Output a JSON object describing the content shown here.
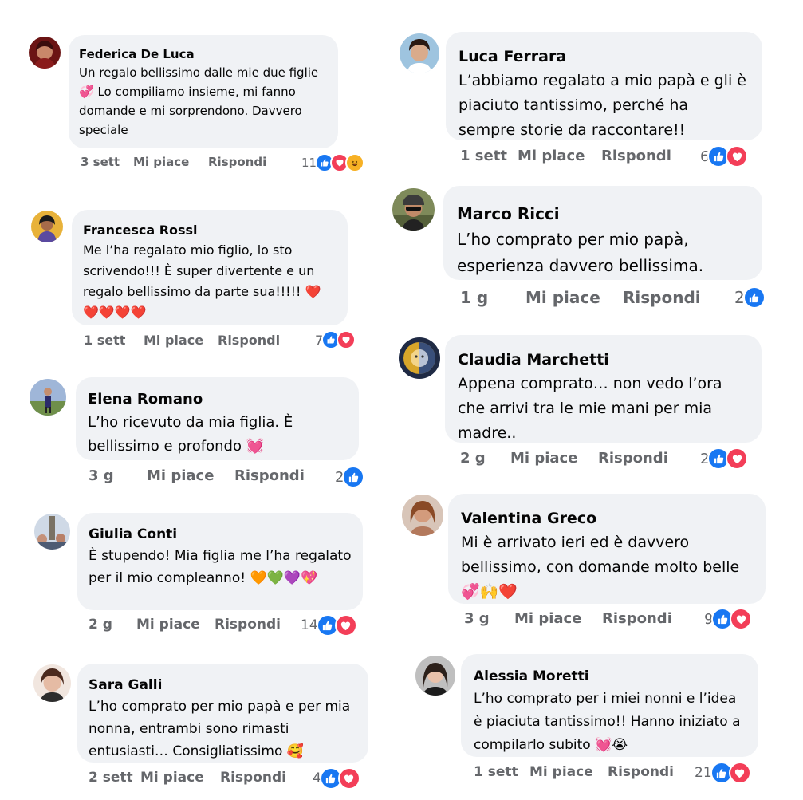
{
  "colors": {
    "bubble": "#f0f2f5",
    "meta_text": "#65676b",
    "like": "#1877f2",
    "love": "#f33e58",
    "haha": "#f7b125"
  },
  "comments": [
    {
      "name": "Federica De Luca",
      "text": "Un regalo bellissimo dalle mie due figlie 💞 Lo compiliamo insieme, mi fanno domande e mi sorprendono. Davvero speciale",
      "time": "3 sett",
      "like": "Mi piace",
      "reply": "Rispondi",
      "count": "11",
      "reactions": [
        "like-icon",
        "love-icon",
        "haha-icon"
      ]
    },
    {
      "name": "Francesca Rossi",
      "text": "Me l’ha regalato mio figlio, lo sto scrivendo!!! È super divertente e un regalo bellissimo da parte sua!!!!! ❤️❤️❤️❤️❤️",
      "time": "1 sett",
      "like": "Mi piace",
      "reply": "Rispondi",
      "count": "7",
      "reactions": [
        "like-icon",
        "love-icon"
      ]
    },
    {
      "name": "Elena Romano",
      "text": "L’ho ricevuto da mia figlia. È bellissimo e profondo 💓",
      "time": "3 g",
      "like": "Mi piace",
      "reply": "Rispondi",
      "count": "2",
      "reactions": [
        "like-icon"
      ]
    },
    {
      "name": "Giulia Conti",
      "text": "È stupendo! Mia figlia me l’ha regalato per il mio compleanno! 🧡💚💜💖",
      "time": "2 g",
      "like": "Mi piace",
      "reply": "Rispondi",
      "count": "14",
      "reactions": [
        "like-icon",
        "love-icon"
      ]
    },
    {
      "name": "Sara Galli",
      "text": "L’ho comprato per mio papà e per mia nonna, entrambi sono rimasti entusiasti… Consigliatissimo 🥰",
      "time": "2 sett",
      "like": "Mi piace",
      "reply": "Rispondi",
      "count": "4",
      "reactions": [
        "like-icon",
        "love-icon"
      ]
    },
    {
      "name": "Luca Ferrara",
      "text": "L’abbiamo regalato a mio papà e gli è piaciuto tantissimo, perché ha sempre storie da raccontare!!",
      "time": "1 sett",
      "like": "Mi piace",
      "reply": "Rispondi",
      "count": "6",
      "reactions": [
        "like-icon",
        "love-icon"
      ]
    },
    {
      "name": "Marco Ricci",
      "text": "L’ho comprato per mio papà, esperienza davvero bellissima.",
      "time": "1 g",
      "like": "Mi piace",
      "reply": "Rispondi",
      "count": "2",
      "reactions": [
        "like-icon"
      ]
    },
    {
      "name": "Claudia Marchetti",
      "text": "Appena comprato… non vedo l’ora che arrivi tra le mie mani per mia madre..",
      "time": "2 g",
      "like": "Mi piace",
      "reply": "Rispondi",
      "count": "2",
      "reactions": [
        "like-icon",
        "love-icon"
      ]
    },
    {
      "name": "Valentina Greco",
      "text": "Mi è arrivato ieri ed è davvero bellissimo, con domande molto belle 💞🙌❤️",
      "time": "3 g",
      "like": "Mi piace",
      "reply": "Rispondi",
      "count": "9",
      "reactions": [
        "like-icon",
        "love-icon"
      ]
    },
    {
      "name": "Alessia Moretti",
      "text": "L’ho comprato per i miei nonni e l’idea è piaciuta tantissimo!! Hanno iniziato a compilarlo subito 💓😭",
      "time": "1 sett",
      "like": "Mi piace",
      "reply": "Rispondi",
      "count": "21",
      "reactions": [
        "like-icon",
        "love-icon"
      ]
    }
  ]
}
